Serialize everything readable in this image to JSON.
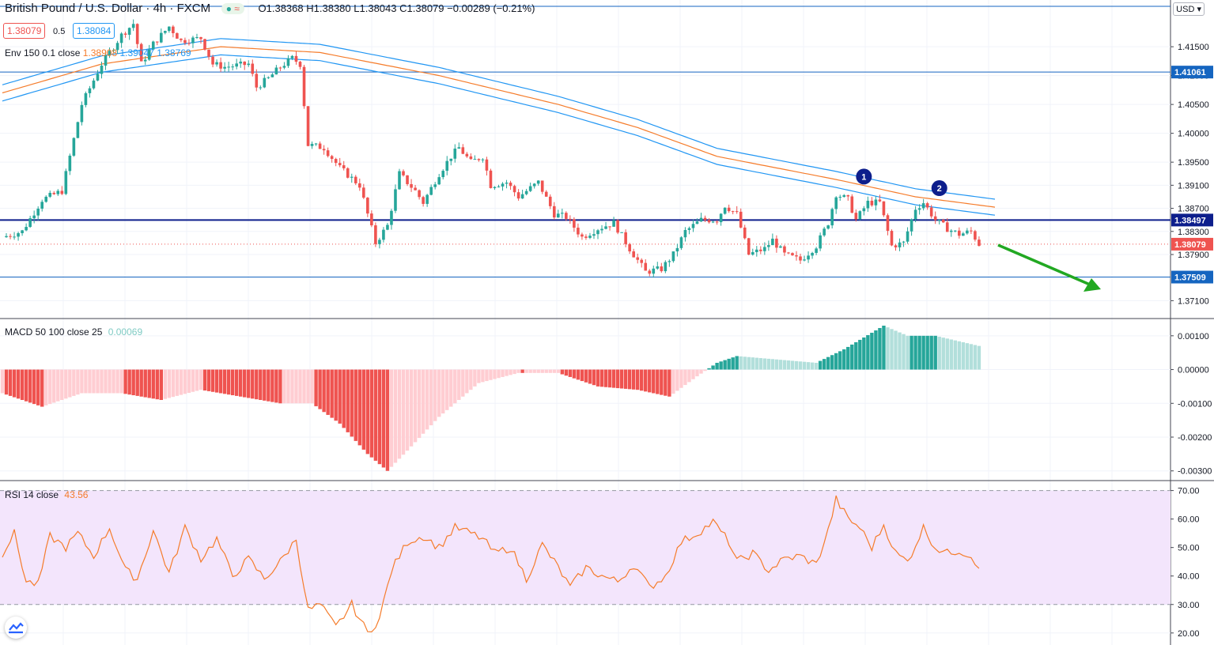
{
  "header": {
    "symbol": "British Pound / U.S. Dollar · 4h · FXCM",
    "open": "O1.38368",
    "high": "H1.38380",
    "low": "L1.38043",
    "close": "C1.38079",
    "change": "−0.00289 (−0.21%)",
    "bid": "1.38079",
    "spread": "0.5",
    "ask": "1.38084",
    "env_label": "Env 150 0.1 close",
    "env_values": [
      "1.38908",
      "1.39047",
      "1.38769"
    ],
    "currency": "USD"
  },
  "macd_label": "MACD 50 100 close 25",
  "macd_value": "0.00069",
  "rsi_label": "RSI 14 close",
  "rsi_value": "43.56",
  "colors": {
    "bull": "#26a69a",
    "bear": "#ef5350",
    "env_mid": "#f57c2b",
    "env_band": "#2196f3",
    "hist_bull": "#26a69a",
    "hist_bull_light": "#b2dfdb",
    "hist_bear": "#ef5350",
    "hist_bear_light": "#ffcdd2",
    "rsi": "#f57c2b",
    "rsi_bg": "#f3e5fc",
    "level": "#1565c0",
    "strong_level": "#0d1e8c",
    "arrow": "#22a822"
  },
  "chart_data": [
    {
      "type": "candlestick",
      "pane": "price",
      "yaxis_ticks": [
        "1.41500",
        "1.41000",
        "1.40500",
        "1.40000",
        "1.39500",
        "1.39100",
        "1.38700",
        "1.38300",
        "1.37900",
        "1.37100"
      ],
      "ylim": [
        1.369,
        1.422
      ],
      "anchors": [
        [
          0,
          1.382
        ],
        [
          5,
          1.383
        ],
        [
          10,
          1.3885
        ],
        [
          15,
          1.39
        ],
        [
          20,
          1.405
        ],
        [
          25,
          1.412
        ],
        [
          30,
          1.417
        ],
        [
          33,
          1.419
        ],
        [
          35,
          1.412
        ],
        [
          38,
          1.4155
        ],
        [
          42,
          1.4185
        ],
        [
          45,
          1.416
        ],
        [
          50,
          1.4165
        ],
        [
          53,
          1.412
        ],
        [
          56,
          1.4115
        ],
        [
          62,
          1.412
        ],
        [
          64,
          1.408
        ],
        [
          67,
          1.4095
        ],
        [
          70,
          1.4115
        ],
        [
          73,
          1.413
        ],
        [
          75,
          1.412
        ],
        [
          77,
          1.398
        ],
        [
          81,
          1.3975
        ],
        [
          85,
          1.394
        ],
        [
          90,
          1.391
        ],
        [
          92,
          1.386
        ],
        [
          94,
          1.381
        ],
        [
          97,
          1.384
        ],
        [
          100,
          1.393
        ],
        [
          104,
          1.39
        ],
        [
          106,
          1.388
        ],
        [
          110,
          1.393
        ],
        [
          113,
          1.396
        ],
        [
          115,
          1.3975
        ],
        [
          118,
          1.395
        ],
        [
          121,
          1.396
        ],
        [
          123,
          1.391
        ],
        [
          127,
          1.3915
        ],
        [
          130,
          1.389
        ],
        [
          135,
          1.3915
        ],
        [
          139,
          1.386
        ],
        [
          142,
          1.3855
        ],
        [
          146,
          1.382
        ],
        [
          150,
          1.3835
        ],
        [
          154,
          1.3845
        ],
        [
          158,
          1.38
        ],
        [
          162,
          1.376
        ],
        [
          166,
          1.3765
        ],
        [
          169,
          1.379
        ],
        [
          172,
          1.383
        ],
        [
          176,
          1.385
        ],
        [
          180,
          1.385
        ],
        [
          182,
          1.3875
        ],
        [
          185,
          1.386
        ],
        [
          188,
          1.379
        ],
        [
          192,
          1.38
        ],
        [
          194,
          1.3815
        ],
        [
          197,
          1.379
        ],
        [
          201,
          1.378
        ],
        [
          205,
          1.3805
        ],
        [
          208,
          1.3845
        ],
        [
          210,
          1.3895
        ],
        [
          213,
          1.3885
        ],
        [
          215,
          1.385
        ],
        [
          218,
          1.388
        ],
        [
          221,
          1.388
        ],
        [
          224,
          1.3805
        ],
        [
          227,
          1.381
        ],
        [
          230,
          1.387
        ],
        [
          232,
          1.388
        ],
        [
          235,
          1.385
        ],
        [
          238,
          1.3835
        ],
        [
          241,
          1.3825
        ],
        [
          244,
          1.383
        ],
        [
          246,
          1.3808
        ]
      ],
      "levels": [
        {
          "value": 1.422,
          "label": "",
          "style": "line"
        },
        {
          "value": 1.41061,
          "label": "1.41061",
          "style": "line"
        },
        {
          "value": 1.38497,
          "label": "1.38497",
          "style": "strong"
        },
        {
          "value": 1.37509,
          "label": "1.37509",
          "style": "line"
        },
        {
          "value": 1.38079,
          "label": "1.38079",
          "style": "dotted"
        }
      ],
      "markers": [
        {
          "label": "1",
          "x": 217,
          "y": 1.3925
        },
        {
          "label": "2",
          "x": 236,
          "y": 1.3905
        }
      ],
      "envelope": {
        "mid_anchors": [
          [
            0,
            1.407
          ],
          [
            25,
            1.412
          ],
          [
            55,
            1.415
          ],
          [
            80,
            1.414
          ],
          [
            110,
            1.41
          ],
          [
            140,
            1.405
          ],
          [
            160,
            1.401
          ],
          [
            180,
            1.396
          ],
          [
            210,
            1.392
          ],
          [
            230,
            1.389
          ],
          [
            250,
            1.3872
          ]
        ],
        "pct": 0.1
      }
    },
    {
      "type": "histogram",
      "pane": "macd",
      "yaxis_ticks": [
        "0.00100",
        "0.00000",
        "-0.00100",
        "-0.00200",
        "-0.00300"
      ],
      "ylim": [
        -0.0031,
        0.0013
      ],
      "anchors": [
        [
          0,
          -0.0007
        ],
        [
          10,
          -0.0011
        ],
        [
          20,
          -0.0007
        ],
        [
          30,
          -0.0007
        ],
        [
          40,
          -0.0009
        ],
        [
          50,
          -0.0006
        ],
        [
          60,
          -0.0008
        ],
        [
          70,
          -0.001
        ],
        [
          78,
          -0.001
        ],
        [
          85,
          -0.0016
        ],
        [
          92,
          -0.0025
        ],
        [
          97,
          -0.003
        ],
        [
          102,
          -0.0024
        ],
        [
          110,
          -0.0014
        ],
        [
          120,
          -0.0004
        ],
        [
          130,
          -0.0001
        ],
        [
          140,
          -0.0001
        ],
        [
          150,
          -0.0005
        ],
        [
          160,
          -0.0006
        ],
        [
          168,
          -0.0008
        ],
        [
          175,
          -0.0002
        ],
        [
          180,
          0.0002
        ],
        [
          185,
          0.0004
        ],
        [
          195,
          0.0003
        ],
        [
          205,
          0.0002
        ],
        [
          212,
          0.0006
        ],
        [
          222,
          0.0013
        ],
        [
          228,
          0.001
        ],
        [
          235,
          0.001
        ],
        [
          246,
          0.0007
        ]
      ]
    },
    {
      "type": "line",
      "pane": "rsi",
      "yaxis_ticks": [
        "70.00",
        "60.00",
        "50.00",
        "40.00",
        "30.00",
        "20.00"
      ],
      "ylim": [
        18,
        71
      ],
      "bands": [
        30,
        70
      ],
      "anchors": [
        [
          0,
          48
        ],
        [
          3,
          55
        ],
        [
          6,
          38
        ],
        [
          9,
          37
        ],
        [
          12,
          54
        ],
        [
          16,
          50
        ],
        [
          19,
          55
        ],
        [
          23,
          47
        ],
        [
          27,
          57
        ],
        [
          31,
          42
        ],
        [
          34,
          39
        ],
        [
          38,
          56
        ],
        [
          42,
          41
        ],
        [
          46,
          57
        ],
        [
          50,
          46
        ],
        [
          54,
          53
        ],
        [
          58,
          40
        ],
        [
          62,
          46
        ],
        [
          66,
          39
        ],
        [
          70,
          45
        ],
        [
          74,
          53
        ],
        [
          77,
          28
        ],
        [
          80,
          30
        ],
        [
          84,
          22
        ],
        [
          88,
          30
        ],
        [
          92,
          20
        ],
        [
          95,
          25
        ],
        [
          98,
          42
        ],
        [
          102,
          52
        ],
        [
          106,
          54
        ],
        [
          110,
          50
        ],
        [
          114,
          57
        ],
        [
          118,
          55
        ],
        [
          121,
          53
        ],
        [
          124,
          48
        ],
        [
          128,
          50
        ],
        [
          132,
          39
        ],
        [
          136,
          51
        ],
        [
          140,
          43
        ],
        [
          143,
          36
        ],
        [
          147,
          43
        ],
        [
          151,
          40
        ],
        [
          155,
          38
        ],
        [
          159,
          44
        ],
        [
          163,
          36
        ],
        [
          167,
          40
        ],
        [
          171,
          52
        ],
        [
          175,
          55
        ],
        [
          179,
          59
        ],
        [
          183,
          52
        ],
        [
          185,
          45
        ],
        [
          189,
          48
        ],
        [
          193,
          42
        ],
        [
          197,
          46
        ],
        [
          201,
          47
        ],
        [
          205,
          44
        ],
        [
          208,
          56
        ],
        [
          210,
          67
        ],
        [
          213,
          60
        ],
        [
          216,
          57
        ],
        [
          219,
          50
        ],
        [
          222,
          58
        ],
        [
          225,
          48
        ],
        [
          228,
          45
        ],
        [
          232,
          57
        ],
        [
          235,
          50
        ],
        [
          238,
          48
        ],
        [
          241,
          49
        ],
        [
          244,
          47
        ],
        [
          246,
          43.6
        ]
      ]
    }
  ]
}
